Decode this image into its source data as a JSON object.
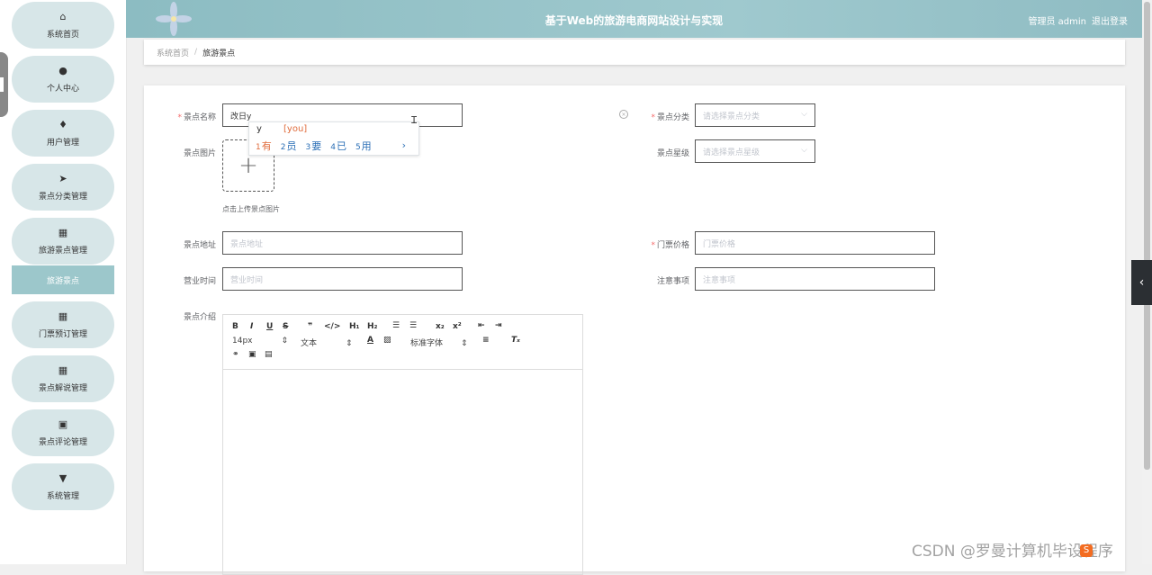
{
  "header": {
    "title": "基于Web的旅游电商网站设计与实现",
    "user_label": "管理员 admin",
    "logout": "退出登录"
  },
  "sidebar": {
    "items": [
      {
        "label": "系统首页",
        "icon": "home-icon",
        "glyph": "⌂"
      },
      {
        "label": "个人中心",
        "icon": "user-icon",
        "glyph": "●"
      },
      {
        "label": "用户管理",
        "icon": "pin-icon",
        "glyph": "♦"
      },
      {
        "label": "景点分类管理",
        "icon": "send-icon",
        "glyph": "➤"
      },
      {
        "label": "旅游景点管理",
        "icon": "grid-icon",
        "glyph": "▦"
      },
      {
        "label": "门票预订管理",
        "icon": "grid-icon",
        "glyph": "▦"
      },
      {
        "label": "景点解说管理",
        "icon": "grid-icon",
        "glyph": "▦"
      },
      {
        "label": "景点评论管理",
        "icon": "clipboard-icon",
        "glyph": "▣"
      },
      {
        "label": "系统管理",
        "icon": "setting-icon",
        "glyph": "▼"
      }
    ],
    "sub_active": "旅游景点"
  },
  "breadcrumb": {
    "home": "系统首页",
    "sep": "/",
    "current": "旅游景点"
  },
  "form": {
    "name_label": "景点名称",
    "name_value": "改日y",
    "category_label": "景点分类",
    "category_placeholder": "请选择景点分类",
    "image_label": "景点图片",
    "upload_hint": "点击上传景点图片",
    "level_label": "景点星级",
    "level_placeholder": "请选择景点星级",
    "address_label": "景点地址",
    "address_placeholder": "景点地址",
    "price_label": "门票价格",
    "price_placeholder": "门票价格",
    "hours_label": "营业时间",
    "hours_placeholder": "营业时间",
    "notes_label": "注意事项",
    "notes_placeholder": "注意事项",
    "intro_label": "景点介绍"
  },
  "ime": {
    "composition": "y",
    "pinyin": "[you]",
    "candidates": [
      {
        "n": "1",
        "c": "有"
      },
      {
        "n": "2",
        "c": "员"
      },
      {
        "n": "3",
        "c": "要"
      },
      {
        "n": "4",
        "c": "已"
      },
      {
        "n": "5",
        "c": "用"
      }
    ],
    "more": "›"
  },
  "editor": {
    "font_size": "14px",
    "text_style": "文本",
    "font_family": "标准字体"
  },
  "watermark": "CSDN @罗曼计算机毕设程序"
}
